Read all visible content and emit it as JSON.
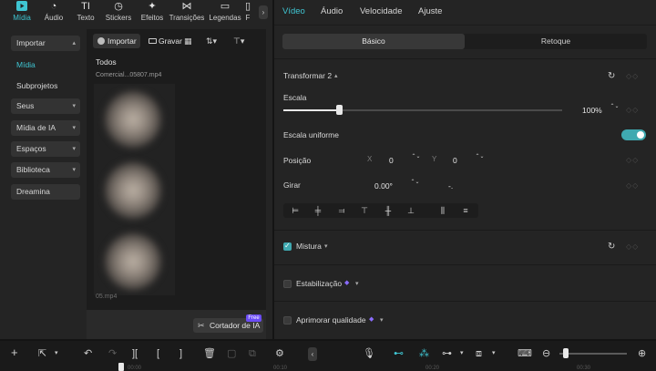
{
  "topnav": {
    "items": [
      {
        "label": "Mídia",
        "icon": "media-icon",
        "glyph": "▶"
      },
      {
        "label": "Áudio",
        "icon": "audio-icon",
        "glyph": "◔"
      },
      {
        "label": "Texto",
        "icon": "text-icon",
        "glyph": "TI"
      },
      {
        "label": "Stickers",
        "icon": "stickers-icon",
        "glyph": "◷"
      },
      {
        "label": "Efeitos",
        "icon": "effects-icon",
        "glyph": "✦"
      },
      {
        "label": "Transições",
        "icon": "transitions-icon",
        "glyph": "⋈"
      },
      {
        "label": "Legendas",
        "icon": "captions-icon",
        "glyph": "▭"
      },
      {
        "label": "F",
        "icon": "filters-icon",
        "glyph": "▯"
      }
    ],
    "more_glyph": "›"
  },
  "sidebar": {
    "items": [
      {
        "label": "Importar",
        "chevron": "▴"
      },
      {
        "label": "Mídia",
        "chevron": ""
      },
      {
        "label": "Subprojetos",
        "chevron": ""
      },
      {
        "label": "Seus",
        "chevron": "▾"
      },
      {
        "label": "Mídia de IA",
        "chevron": "▾"
      },
      {
        "label": "Espaços",
        "chevron": "▾"
      },
      {
        "label": "Biblioteca",
        "chevron": "▾"
      },
      {
        "label": "Dreamina",
        "chevron": ""
      }
    ]
  },
  "media": {
    "import_label": "Importar",
    "record_label": "Gravar",
    "grid_glyph": "▦",
    "sort_glyph": "⇅▾",
    "filter_glyph": "⊤▾",
    "section_label": "Todos",
    "file_name": "Comercial...05807.mp4",
    "file_name_2": "05.mp4",
    "cutter_label": "Cortador de IA",
    "cutter_glyph": "✂",
    "free_badge": "Free"
  },
  "right": {
    "tabs": [
      "Vídeo",
      "Áudio",
      "Velocidade",
      "Ajuste"
    ],
    "segments": [
      "Básico",
      "Retoque"
    ],
    "transform_title": "Transformar 2",
    "scale_label": "Escala",
    "scale_value": "100%",
    "scale_fraction": 0.2,
    "uniform_scale_label": "Escala uniforme",
    "uniform_scale_on": true,
    "position_label": "Posição",
    "x_label": "X",
    "x_value": "0",
    "y_label": "Y",
    "y_value": "0",
    "rotate_label": "Girar",
    "rotate_value": "0.00°",
    "rotate_extra": "-.",
    "mix_label": "Mistura",
    "stabilize_label": "Estabilização",
    "enhance_label": "Aprimorar qualidade",
    "keyframe_glyph": "◇◇",
    "reset_glyph": "↻",
    "stepper_glyph": "⌃⌄"
  },
  "timeline": {
    "ticks": [
      "00:00",
      "00:10",
      "00:20",
      "00:30"
    ]
  },
  "colors": {
    "accent": "#3fc5d2",
    "toggle": "#3fa9b0",
    "badge": "#6b4cf6"
  }
}
